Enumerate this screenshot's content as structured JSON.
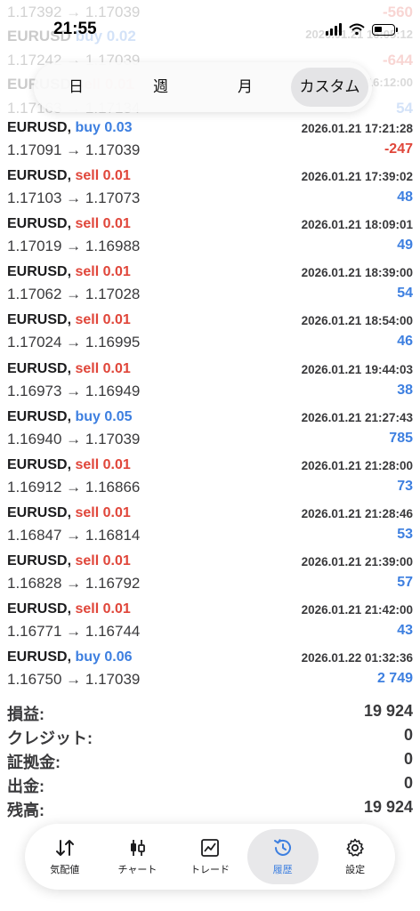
{
  "status_bar": {
    "time": "21:55"
  },
  "faded_rows": [
    {
      "kind": "prices",
      "prices": "1.17392 → 1.17039",
      "right": "-560",
      "right_class": "neg"
    },
    {
      "kind": "deal",
      "symbol": "EURUSD",
      "side": "buy 0.02",
      "side_class": "blue",
      "right": "2026.01.21 16:05:12",
      "right_class": "gray"
    },
    {
      "kind": "prices",
      "prices": "1.17242 → 1.17039",
      "right": "-644",
      "right_class": "neg"
    },
    {
      "kind": "deal",
      "symbol": "EURUSD",
      "side": "sell 0.01",
      "side_class": "red",
      "right": "2026.01.21 16:12:00",
      "right_class": "gray"
    },
    {
      "kind": "prices",
      "prices": "1.17163 → 1.17134",
      "right": "54",
      "right_class": "pos"
    }
  ],
  "period_tabs": [
    {
      "label": "日"
    },
    {
      "label": "週"
    },
    {
      "label": "月"
    },
    {
      "label": "カスタム",
      "active": true
    }
  ],
  "deals": [
    {
      "symbol": "EURUSD,",
      "side": "buy 0.03",
      "type": "buy",
      "time": "2026.01.21 17:21:28",
      "prices": "1.17091 → 1.17039",
      "profit": "-247",
      "profit_class": "neg"
    },
    {
      "symbol": "EURUSD,",
      "side": "sell 0.01",
      "type": "sell",
      "time": "2026.01.21 17:39:02",
      "prices": "1.17103 → 1.17073",
      "profit": "48",
      "profit_class": "pos"
    },
    {
      "symbol": "EURUSD,",
      "side": "sell 0.01",
      "type": "sell",
      "time": "2026.01.21 18:09:01",
      "prices": "1.17019 → 1.16988",
      "profit": "49",
      "profit_class": "pos"
    },
    {
      "symbol": "EURUSD,",
      "side": "sell 0.01",
      "type": "sell",
      "time": "2026.01.21 18:39:00",
      "prices": "1.17062 → 1.17028",
      "profit": "54",
      "profit_class": "pos"
    },
    {
      "symbol": "EURUSD,",
      "side": "sell 0.01",
      "type": "sell",
      "time": "2026.01.21 18:54:00",
      "prices": "1.17024 → 1.16995",
      "profit": "46",
      "profit_class": "pos"
    },
    {
      "symbol": "EURUSD,",
      "side": "sell 0.01",
      "type": "sell",
      "time": "2026.01.21 19:44:03",
      "prices": "1.16973 → 1.16949",
      "profit": "38",
      "profit_class": "pos"
    },
    {
      "symbol": "EURUSD,",
      "side": "buy 0.05",
      "type": "buy",
      "time": "2026.01.21 21:27:43",
      "prices": "1.16940 → 1.17039",
      "profit": "785",
      "profit_class": "pos"
    },
    {
      "symbol": "EURUSD,",
      "side": "sell 0.01",
      "type": "sell",
      "time": "2026.01.21 21:28:00",
      "prices": "1.16912 → 1.16866",
      "profit": "73",
      "profit_class": "pos"
    },
    {
      "symbol": "EURUSD,",
      "side": "sell 0.01",
      "type": "sell",
      "time": "2026.01.21 21:28:46",
      "prices": "1.16847 → 1.16814",
      "profit": "53",
      "profit_class": "pos"
    },
    {
      "symbol": "EURUSD,",
      "side": "sell 0.01",
      "type": "sell",
      "time": "2026.01.21 21:39:00",
      "prices": "1.16828 → 1.16792",
      "profit": "57",
      "profit_class": "pos"
    },
    {
      "symbol": "EURUSD,",
      "side": "sell 0.01",
      "type": "sell",
      "time": "2026.01.21 21:42:00",
      "prices": "1.16771 → 1.16744",
      "profit": "43",
      "profit_class": "pos"
    },
    {
      "symbol": "EURUSD,",
      "side": "buy 0.06",
      "type": "buy",
      "time": "2026.01.22 01:32:36",
      "prices": "1.16750 → 1.17039",
      "profit": "2 749",
      "profit_class": "pos"
    }
  ],
  "summary": [
    {
      "label": "損益:",
      "value": "19 924"
    },
    {
      "label": "クレジット:",
      "value": "0"
    },
    {
      "label": "証拠金:",
      "value": "0"
    },
    {
      "label": "出金:",
      "value": "0"
    },
    {
      "label": "残高:",
      "value": "19 924"
    }
  ],
  "nav": [
    {
      "label": "気配値",
      "icon": "quotes-arrows-icon"
    },
    {
      "label": "チャート",
      "icon": "candlestick-icon"
    },
    {
      "label": "トレード",
      "icon": "trade-chart-icon"
    },
    {
      "label": "履歴",
      "icon": "history-clock-icon",
      "active": true
    },
    {
      "label": "設定",
      "icon": "gear-icon"
    }
  ],
  "colors": {
    "buy": "#3d7fe0",
    "sell": "#e0463a",
    "text": "#1c1c1e"
  }
}
